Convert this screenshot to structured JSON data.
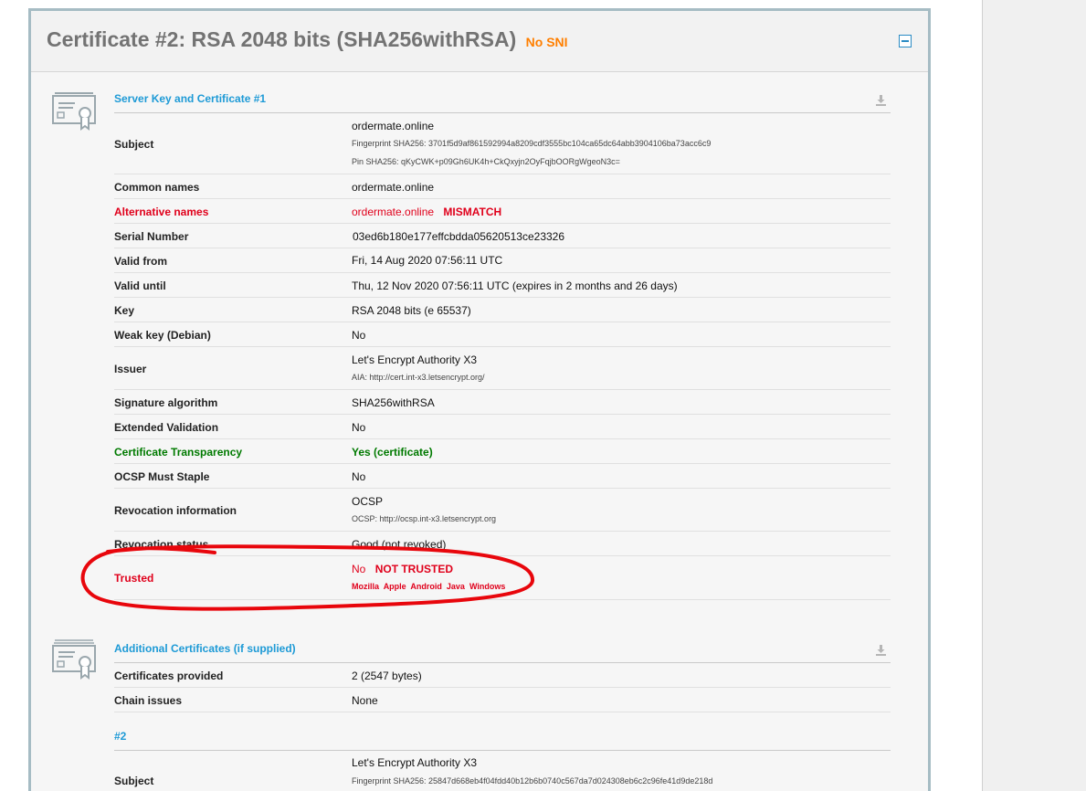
{
  "card": {
    "title": "Certificate #2: RSA 2048 bits (SHA256withRSA)",
    "badge": "No SNI",
    "colors": {
      "accent": "#1d9ad6",
      "warning": "#ff7f00",
      "error": "#e0001b",
      "success": "#007a00",
      "border": "#a6bcc4"
    }
  },
  "server_key": {
    "title": "Server Key and Certificate #1",
    "subject": {
      "label": "Subject",
      "value": "ordermate.online",
      "fingerprint": "Fingerprint SHA256: 3701f5d9af861592994a8209cdf3555bc104ca65dc64abb3904106ba73acc6c9",
      "pin": "Pin SHA256: qKyCWK+p09Gh6UK4h+CkQxyjn2OyFqjbOORgWgeoN3c="
    },
    "common_names": {
      "label": "Common names",
      "value": "ordermate.online"
    },
    "alt_names": {
      "label": "Alternative names",
      "value": "ordermate.online",
      "flag": "MISMATCH"
    },
    "serial": {
      "label": "Serial Number",
      "value": "03ed6b180e177effcbdda05620513ce23326"
    },
    "valid_from": {
      "label": "Valid from",
      "value": "Fri, 14 Aug 2020 07:56:11 UTC"
    },
    "valid_until": {
      "label": "Valid until",
      "value": "Thu, 12 Nov 2020 07:56:11 UTC (expires in 2 months and 26 days)"
    },
    "key": {
      "label": "Key",
      "value": "RSA 2048 bits (e 65537)"
    },
    "weak_key": {
      "label": "Weak key (Debian)",
      "value": "No"
    },
    "issuer": {
      "label": "Issuer",
      "value": "Let's Encrypt Authority X3",
      "aia": "AIA: http://cert.int-x3.letsencrypt.org/"
    },
    "sig_alg": {
      "label": "Signature algorithm",
      "value": "SHA256withRSA"
    },
    "ev": {
      "label": "Extended Validation",
      "value": "No"
    },
    "ct": {
      "label": "Certificate Transparency",
      "value": "Yes (certificate)"
    },
    "ocsp_staple": {
      "label": "OCSP Must Staple",
      "value": "No"
    },
    "revocation_info": {
      "label": "Revocation information",
      "value": "OCSP",
      "ocsp": "OCSP: http://ocsp.int-x3.letsencrypt.org"
    },
    "revocation_status": {
      "label": "Revocation status",
      "value": "Good (not revoked)"
    },
    "trusted": {
      "label": "Trusted",
      "value": "No",
      "flag": "NOT TRUSTED",
      "stores": [
        "Mozilla",
        "Apple",
        "Android",
        "Java",
        "Windows"
      ]
    }
  },
  "additional": {
    "title": "Additional Certificates (if supplied)",
    "provided": {
      "label": "Certificates provided",
      "value": "2 (2547 bytes)"
    },
    "chain_issues": {
      "label": "Chain issues",
      "value": "None"
    },
    "cert2": {
      "heading": "#2",
      "subject_label": "Subject",
      "subject_value": "Let's Encrypt Authority X3",
      "fingerprint": "Fingerprint SHA256: 25847d668eb4f04fdd40b12b6b0740c567da7d024308eb6c2c96fe41d9de218d"
    }
  },
  "icons": {
    "cert": "certificate-icon",
    "download": "download-icon",
    "collapse": "collapse-icon"
  }
}
